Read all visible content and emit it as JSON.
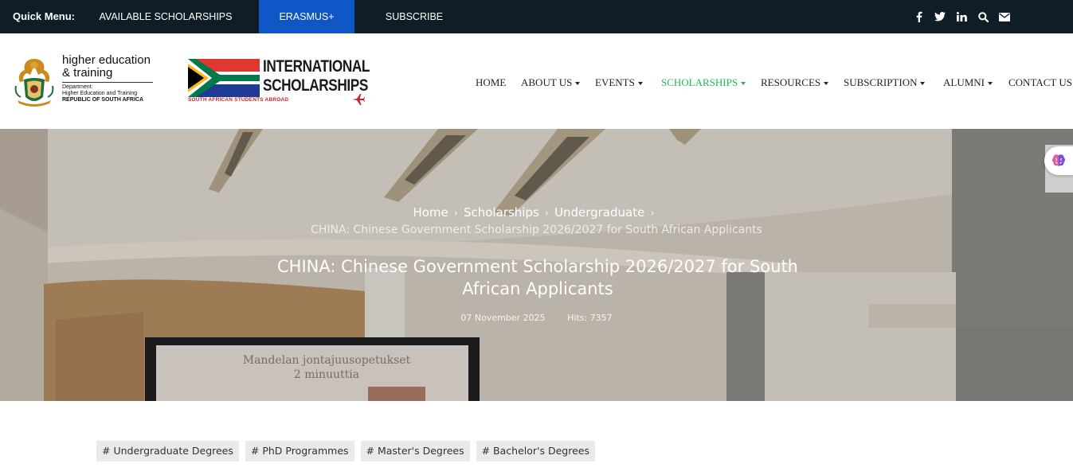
{
  "topbar": {
    "quick_menu": "Quick Menu:",
    "links": [
      {
        "label": "AVAILABLE SCHOLARSHIPS",
        "active": false
      },
      {
        "label": "ERASMUS+",
        "active": true
      },
      {
        "label": "SUBSCRIBE",
        "active": false
      }
    ],
    "social_icons": [
      "facebook-icon",
      "twitter-icon",
      "linkedin-icon",
      "search-icon",
      "envelope-icon"
    ],
    "accent_color": "#0f56c7",
    "background_color": "#0f1e26"
  },
  "logos": {
    "dhet": {
      "line1": "higher education",
      "line2": "& training",
      "dept_line1": "Department:",
      "dept_line2": "Higher Education and Training",
      "dept_line3": "REPUBLIC OF SOUTH AFRICA"
    },
    "intl": {
      "line1": "INTERNATIONAL",
      "line2": "SCHOLARSHIPS",
      "tagline": "SOUTH AFRICAN STUDENTS ABROAD"
    }
  },
  "nav": {
    "items": [
      {
        "label": "HOME",
        "dropdown": false,
        "active": false
      },
      {
        "label": "ABOUT US",
        "dropdown": true,
        "active": false
      },
      {
        "label": "EVENTS",
        "dropdown": true,
        "active": false
      },
      {
        "label": "SCHOLARSHIPS",
        "dropdown": true,
        "active": true
      },
      {
        "label": "RESOURCES",
        "dropdown": true,
        "active": false
      },
      {
        "label": "SUBSCRIPTION",
        "dropdown": true,
        "active": false
      },
      {
        "label": "ALUMNI",
        "dropdown": true,
        "active": false
      },
      {
        "label": "CONTACT US",
        "dropdown": false,
        "active": false
      }
    ],
    "active_color": "#1eb75a"
  },
  "hero": {
    "breadcrumb": [
      "Home",
      "Scholarships",
      "Undergraduate"
    ],
    "current": "CHINA: Chinese Government Scholarship 2026/2027 for South African Applicants",
    "title_line1": "CHINA: Chinese Government Scholarship 2026/2027 for South",
    "title_line2": "African Applicants",
    "date": "07 November 2025",
    "hits": "Hits: 7357",
    "screen_text_line1": "Mandelan jontajuusopetukset",
    "screen_text_line2": "2 minuuttia"
  },
  "tags": [
    "# Undergraduate Degrees",
    "# PhD Programmes",
    "# Master's Degrees",
    "# Bachelor's Degrees"
  ]
}
